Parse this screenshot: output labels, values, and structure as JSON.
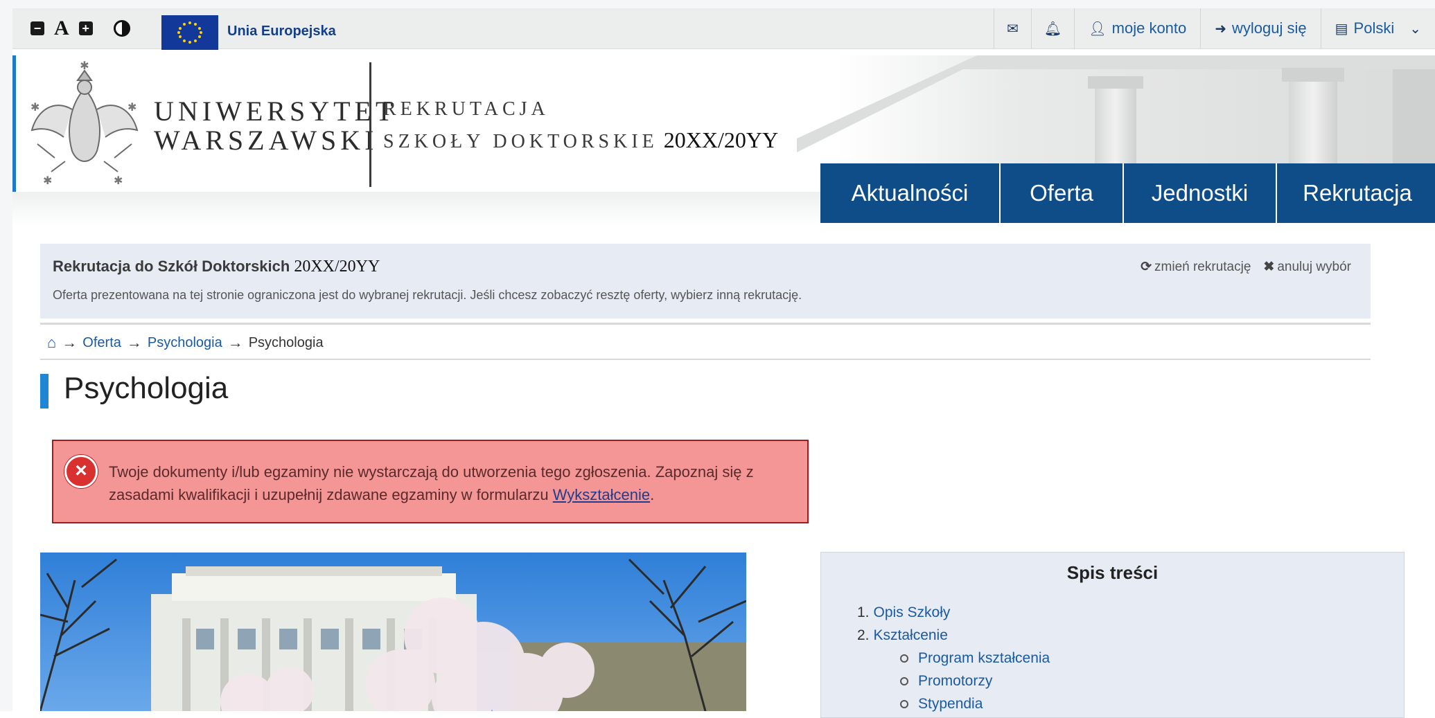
{
  "topbar": {
    "eu_label": "Unia Europejska",
    "my_account": "moje konto",
    "logout": "wyloguj się",
    "language": "Polski"
  },
  "header": {
    "university_line1": "UNIWERSYTET",
    "university_line2": "WARSZAWSKI",
    "rekrutacja": "REKRUTACJA",
    "schools": "SZKOŁY DOKTORSKIE",
    "year": "20XX/20YY"
  },
  "nav": {
    "items": [
      "Aktualności",
      "Oferta",
      "Jednostki",
      "Rekrutacja"
    ]
  },
  "recruitment": {
    "title": "Rekrutacja do Szkół Doktorskich",
    "year": "20XX/20YY",
    "description": "Oferta prezentowana na tej stronie ograniczona jest do wybranej rekrutacji. Jeśli chcesz zobaczyć resztę oferty, wybierz inną rekrutację.",
    "change": "zmień rekrutację",
    "cancel": "anuluj wybór"
  },
  "breadcrumb": {
    "items": [
      "Oferta",
      "Psychologia",
      "Psychologia"
    ]
  },
  "page": {
    "title": "Psychologia"
  },
  "alert": {
    "text": "Twoje dokumenty i/lub egzaminy nie wystarczają do utworzenia tego zgłoszenia. Zapoznaj się z zasadami kwalifikacji i uzupełnij zdawane egzaminy w formularzu",
    "link": "Wykształcenie",
    "suffix": "."
  },
  "toc": {
    "title": "Spis treści",
    "items": [
      {
        "num": "1.",
        "label": "Opis Szkoły"
      },
      {
        "num": "2.",
        "label": "Kształcenie"
      }
    ],
    "subitems": [
      "Program kształcenia",
      "Promotorzy",
      "Stypendia"
    ]
  },
  "colors": {
    "nav_blue": "#0e4d88",
    "link_blue": "#1a5aa0",
    "alert_bg": "#f59696",
    "alert_border": "#a01c1c",
    "panel_bg": "#e7ebf3"
  }
}
